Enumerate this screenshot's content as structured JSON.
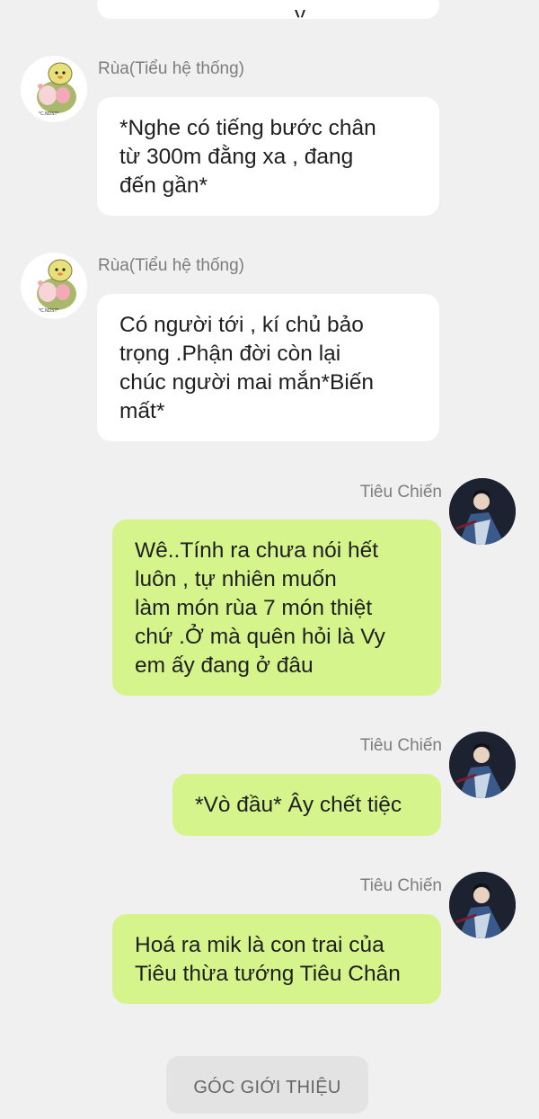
{
  "previous_bubble_fragment": "y",
  "messages": [
    {
      "sender": "Rùa(Tiểu hệ thống)",
      "side": "left",
      "text": "*Nghe có tiếng bước chân\ntừ 300m đằng xa , đang\nđến gần*"
    },
    {
      "sender": "Rùa(Tiểu hệ thống)",
      "side": "left",
      "text": "Có người tới , kí chủ bảo\ntrọng .Phận đời còn lại\nchúc người mai mắn*Biến\nmất*"
    },
    {
      "sender": "Tiêu Chiến",
      "side": "right",
      "text": "Wê..Tính ra chưa nói hết\nluôn , tự nhiên muốn\nlàm món rùa 7 món thiệt\nchứ .Ở mà quên hỏi là Vy\nem ấy đang ở đâu"
    },
    {
      "sender": "Tiêu Chiến",
      "side": "right",
      "text": "*Vò đầu* Ây chết tiệc"
    },
    {
      "sender": "Tiêu Chiến",
      "side": "right",
      "text": "Hoá ra mik là con trai của\nTiêu thừa tướng Tiêu Chân"
    }
  ],
  "bottom_button": {
    "label": "GÓC GIỚI THIỆU"
  },
  "colors": {
    "background": "#f0f0f0",
    "bot_bubble": "#ffffff",
    "user_bubble": "#d5f48c"
  },
  "icons": {
    "bot_avatar": "turtle-sticker-avatar",
    "user_avatar": "character-portrait-avatar"
  }
}
